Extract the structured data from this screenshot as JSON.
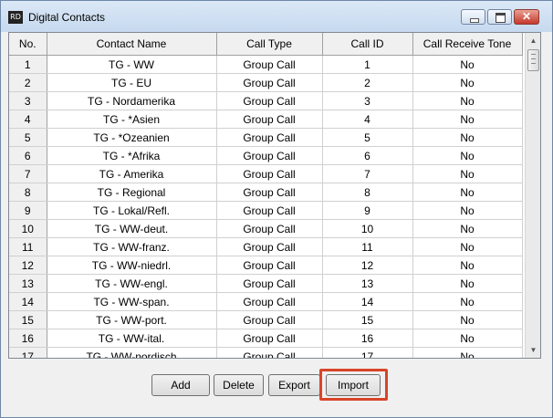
{
  "window": {
    "title": "Digital Contacts",
    "icon": "app-icon"
  },
  "table": {
    "columns": [
      "No.",
      "Contact Name",
      "Call Type",
      "Call ID",
      "Call Receive Tone"
    ],
    "rows": [
      [
        "1",
        "TG - WW",
        "Group Call",
        "1",
        "No"
      ],
      [
        "2",
        "TG - EU",
        "Group Call",
        "2",
        "No"
      ],
      [
        "3",
        "TG - Nordamerika",
        "Group Call",
        "3",
        "No"
      ],
      [
        "4",
        "TG - *Asien",
        "Group Call",
        "4",
        "No"
      ],
      [
        "5",
        "TG - *Ozeanien",
        "Group Call",
        "5",
        "No"
      ],
      [
        "6",
        "TG - *Afrika",
        "Group Call",
        "6",
        "No"
      ],
      [
        "7",
        "TG - Amerika",
        "Group Call",
        "7",
        "No"
      ],
      [
        "8",
        "TG - Regional",
        "Group Call",
        "8",
        "No"
      ],
      [
        "9",
        "TG - Lokal/Refl.",
        "Group Call",
        "9",
        "No"
      ],
      [
        "10",
        "TG - WW-deut.",
        "Group Call",
        "10",
        "No"
      ],
      [
        "11",
        "TG - WW-franz.",
        "Group Call",
        "11",
        "No"
      ],
      [
        "12",
        "TG - WW-niedrl.",
        "Group Call",
        "12",
        "No"
      ],
      [
        "13",
        "TG - WW-engl.",
        "Group Call",
        "13",
        "No"
      ],
      [
        "14",
        "TG - WW-span.",
        "Group Call",
        "14",
        "No"
      ],
      [
        "15",
        "TG - WW-port.",
        "Group Call",
        "15",
        "No"
      ],
      [
        "16",
        "TG - WW-ital.",
        "Group Call",
        "16",
        "No"
      ],
      [
        "17",
        "TG - WW-nordisch",
        "Group Call",
        "17",
        "No"
      ]
    ]
  },
  "buttons": {
    "add": "Add",
    "delete": "Delete",
    "export": "Export",
    "import": "Import"
  },
  "colors": {
    "highlight": "#d9442a",
    "titlebar": "#c6d9ef"
  }
}
